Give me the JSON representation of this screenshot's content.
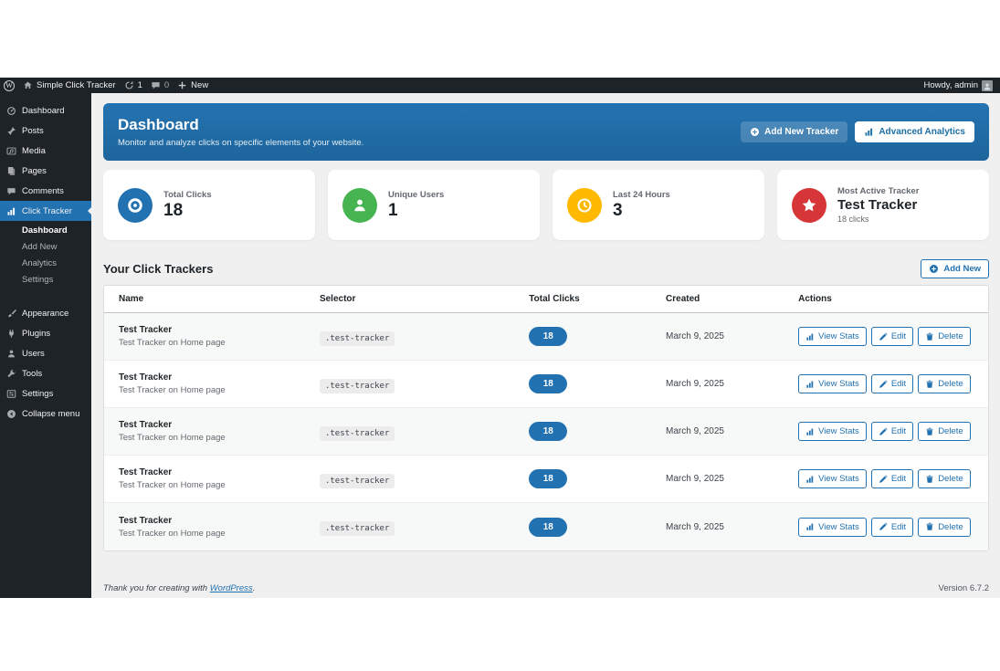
{
  "colors": {
    "accent": "#2271b1",
    "admin_dark": "#1d2327",
    "page_bg": "#f0f0f1"
  },
  "admin_bar": {
    "site_name": "Simple Click Tracker",
    "update_count": "1",
    "comment_count": "0",
    "new_label": "New",
    "howdy": "Howdy, admin"
  },
  "sidebar": {
    "menu_top": [
      {
        "label": "Dashboard",
        "icon": "gauge",
        "active": false
      },
      {
        "label": "Posts",
        "icon": "pin",
        "active": false
      },
      {
        "label": "Media",
        "icon": "media",
        "active": false
      },
      {
        "label": "Pages",
        "icon": "pages",
        "active": false
      },
      {
        "label": "Comments",
        "icon": "comment",
        "active": false
      },
      {
        "label": "Click Tracker",
        "icon": "chart",
        "active": true
      }
    ],
    "submenu": [
      {
        "label": "Dashboard",
        "active": true
      },
      {
        "label": "Add New",
        "active": false
      },
      {
        "label": "Analytics",
        "active": false
      },
      {
        "label": "Settings",
        "active": false
      }
    ],
    "menu_bottom": [
      {
        "label": "Appearance",
        "icon": "brush",
        "active": false
      },
      {
        "label": "Plugins",
        "icon": "plug",
        "active": false
      },
      {
        "label": "Users",
        "icon": "user",
        "active": false
      },
      {
        "label": "Tools",
        "icon": "wrench",
        "active": false
      },
      {
        "label": "Settings",
        "icon": "sliders",
        "active": false
      },
      {
        "label": "Collapse menu",
        "icon": "collapse",
        "active": false
      }
    ]
  },
  "header": {
    "title": "Dashboard",
    "subtitle": "Monitor and analyze clicks on specific elements of your website.",
    "add_new_tracker_label": "Add New Tracker",
    "advanced_analytics_label": "Advanced Analytics"
  },
  "stats": [
    {
      "label": "Total Clicks",
      "value": "18",
      "sub": "",
      "icon": "target",
      "color": "#2271b1"
    },
    {
      "label": "Unique Users",
      "value": "1",
      "sub": "",
      "icon": "user",
      "color": "#46b450"
    },
    {
      "label": "Last 24 Hours",
      "value": "3",
      "sub": "",
      "icon": "clock",
      "color": "#ffb900"
    },
    {
      "label": "Most Active Tracker",
      "value": "Test Tracker",
      "sub": "18 clicks",
      "icon": "star",
      "color": "#d63638"
    }
  ],
  "trackers_section": {
    "title": "Your Click Trackers",
    "add_new_label": "Add New",
    "columns": [
      "Name",
      "Selector",
      "Total Clicks",
      "Created",
      "Actions"
    ],
    "rows": [
      {
        "name": "Test Tracker",
        "description": "Test Tracker on Home page",
        "selector": ".test-tracker",
        "total_clicks": "18",
        "created": "March 9, 2025",
        "view_stats_label": "View Stats",
        "edit_label": "Edit",
        "delete_label": "Delete"
      },
      {
        "name": "Test Tracker",
        "description": "Test Tracker on Home page",
        "selector": ".test-tracker",
        "total_clicks": "18",
        "created": "March 9, 2025",
        "view_stats_label": "View Stats",
        "edit_label": "Edit",
        "delete_label": "Delete"
      },
      {
        "name": "Test Tracker",
        "description": "Test Tracker on Home page",
        "selector": ".test-tracker",
        "total_clicks": "18",
        "created": "March 9, 2025",
        "view_stats_label": "View Stats",
        "edit_label": "Edit",
        "delete_label": "Delete"
      },
      {
        "name": "Test Tracker",
        "description": "Test Tracker on Home page",
        "selector": ".test-tracker",
        "total_clicks": "18",
        "created": "March 9, 2025",
        "view_stats_label": "View Stats",
        "edit_label": "Edit",
        "delete_label": "Delete"
      },
      {
        "name": "Test Tracker",
        "description": "Test Tracker on Home page",
        "selector": ".test-tracker",
        "total_clicks": "18",
        "created": "March 9, 2025",
        "view_stats_label": "View Stats",
        "edit_label": "Edit",
        "delete_label": "Delete"
      }
    ]
  },
  "footer": {
    "thanks_prefix": "Thank you for creating with ",
    "wordpress_link": "WordPress",
    "suffix": ".",
    "version": "Version 6.7.2"
  }
}
